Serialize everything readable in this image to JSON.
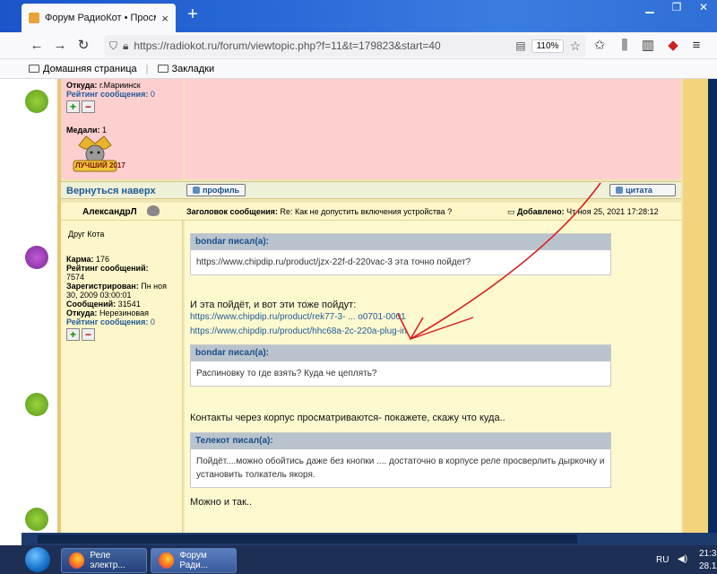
{
  "browser": {
    "tab_title": "Форум РадиоКот • Просмотр",
    "tab_close": "×",
    "new_tab": "+",
    "url": "https://radiokot.ru/forum/viewtopic.php?f=11&t=179823&start=40",
    "zoom": "110%",
    "bookmarks": [
      "Домашняя страница",
      "Закладки"
    ]
  },
  "post1": {
    "from_label": "Откуда:",
    "from_value": "г.Мариинск",
    "rating_label": "Рейтинг сообщения:",
    "rating_value": "0",
    "medals_label": "Медали:",
    "medals_value": "1",
    "medal_text": "ЛУЧШИЙ 2017",
    "back_to_top": "Вернуться наверх",
    "profile_btn": "профиль",
    "quote_btn": "цитата"
  },
  "post2": {
    "author": "АлександрЛ",
    "rank": "Друг Кота",
    "karma_label": "Карма:",
    "karma_value": "176",
    "rating_msgs_label": "Рейтинг сообщений:",
    "rating_msgs_value": "7574",
    "registered_label": "Зарегистрирован:",
    "registered_value": "Пн ноя 30, 2009 03:00:01",
    "messages_label": "Сообщений:",
    "messages_value": "31541",
    "from_label": "Откуда:",
    "from_value": "Нерезиновая",
    "rating_label": "Рейтинг сообщения:",
    "rating_value": "0",
    "subject_label": "Заголовок сообщения:",
    "subject_value": "Re: Как не допустить включения устройства ?",
    "added_label": "Добавлено:",
    "added_value": "Чт ноя 25, 2021 17:28:12",
    "quote1_head": "bondar писал(а):",
    "quote1_body": "https://www.chipdip.ru/product/jzx-22f-d-220vac-3 эта точно пойдет?",
    "text1": "И эта пойдёт, и вот эти тоже пойдут:",
    "link1": "https://www.chipdip.ru/product/rek77-3- ... o0701-0001",
    "link2": "https://www.chipdip.ru/product/hhc68a-2c-220a-plug-in",
    "quote2_head": "bondar писал(а):",
    "quote2_body": "Распиновку то где взять? Куда че цеплять?",
    "text2": "Контакты через корпус просматриваются- покажете, скажу что куда..",
    "quote3_head": "Телекот писал(а):",
    "quote3_body": "Пойдёт....можно обойтись даже без кнопки .... достаточно в корпусе реле просверлить дыркочку и установить толкатель якоря.",
    "text3": "Можно и так.."
  },
  "taskbar": {
    "task1": "Реле электр...",
    "task2": "Форум Ради...",
    "lang": "RU",
    "time": "21:3",
    "date": "28.1"
  },
  "colors": {
    "post_pink": "#fdcfcf",
    "post_yellow": "#fdf6c9",
    "link_blue": "#225b97",
    "annotation_red": "#d81f1f"
  }
}
